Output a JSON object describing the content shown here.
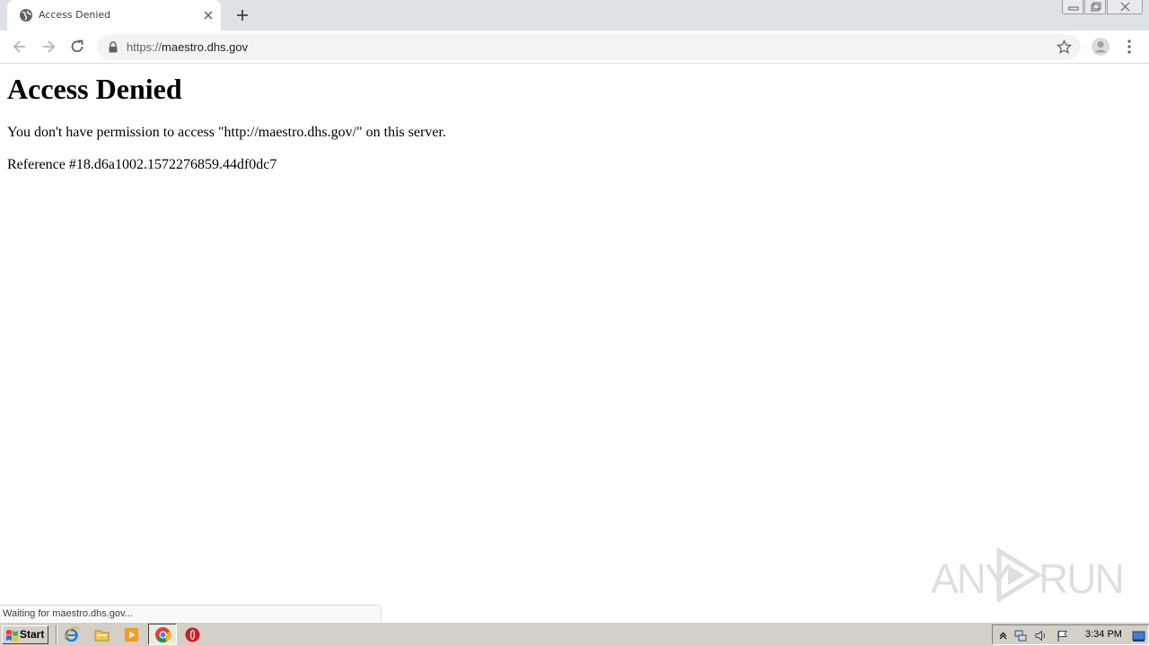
{
  "browser": {
    "tab": {
      "title": "Access Denied"
    },
    "url": {
      "scheme": "https://",
      "host": "maestro.dhs.gov"
    }
  },
  "page": {
    "heading": "Access Denied",
    "message": "You don't have permission to access \"http://maestro.dhs.gov/\" on this server.",
    "reference": "Reference #18.d6a1002.1572276859.44df0dc7"
  },
  "status_bar": {
    "text": "Waiting for maestro.dhs.gov..."
  },
  "watermark": {
    "text_left": "ANY",
    "text_right": "RUN"
  },
  "taskbar": {
    "start_label": "Start",
    "clock": "3:34 PM"
  },
  "colors": {
    "tabstrip_bg": "#dee1e6",
    "omnibox_bg": "#f1f3f4",
    "taskbar_bg": "#d4d0c8"
  }
}
